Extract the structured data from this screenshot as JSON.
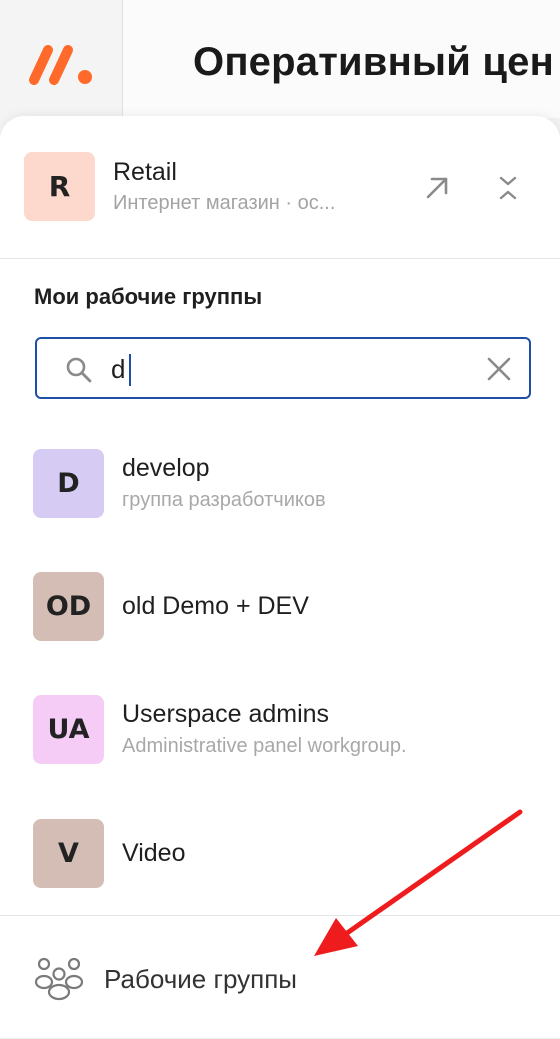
{
  "header": {
    "page_title": "Оперативный цен"
  },
  "workspace": {
    "avatar_initial": "R",
    "name": "Retail",
    "subtitle": "Интернет магазин · ос..."
  },
  "section": {
    "title": "Мои рабочие группы"
  },
  "search": {
    "value": "d",
    "placeholder": ""
  },
  "groups": [
    {
      "initials": "D",
      "name": "develop",
      "description": "группа разработчиков",
      "color": "#d6cbf3"
    },
    {
      "initials": "OD",
      "name": "old Demo + DEV",
      "description": "",
      "color": "#d4bdb4"
    },
    {
      "initials": "UA",
      "name": "Userspace admins",
      "description": "Administrative panel workgroup.",
      "color": "#f4ccf5"
    },
    {
      "initials": "V",
      "name": "Video",
      "description": "",
      "color": "#d4bdb4"
    }
  ],
  "footer": {
    "label": "Рабочие группы",
    "icon": "users-group-icon"
  },
  "colors": {
    "brand": "#ff6a2b",
    "search_border": "#1e4fa8",
    "annotation_arrow": "#ee1c1c"
  }
}
